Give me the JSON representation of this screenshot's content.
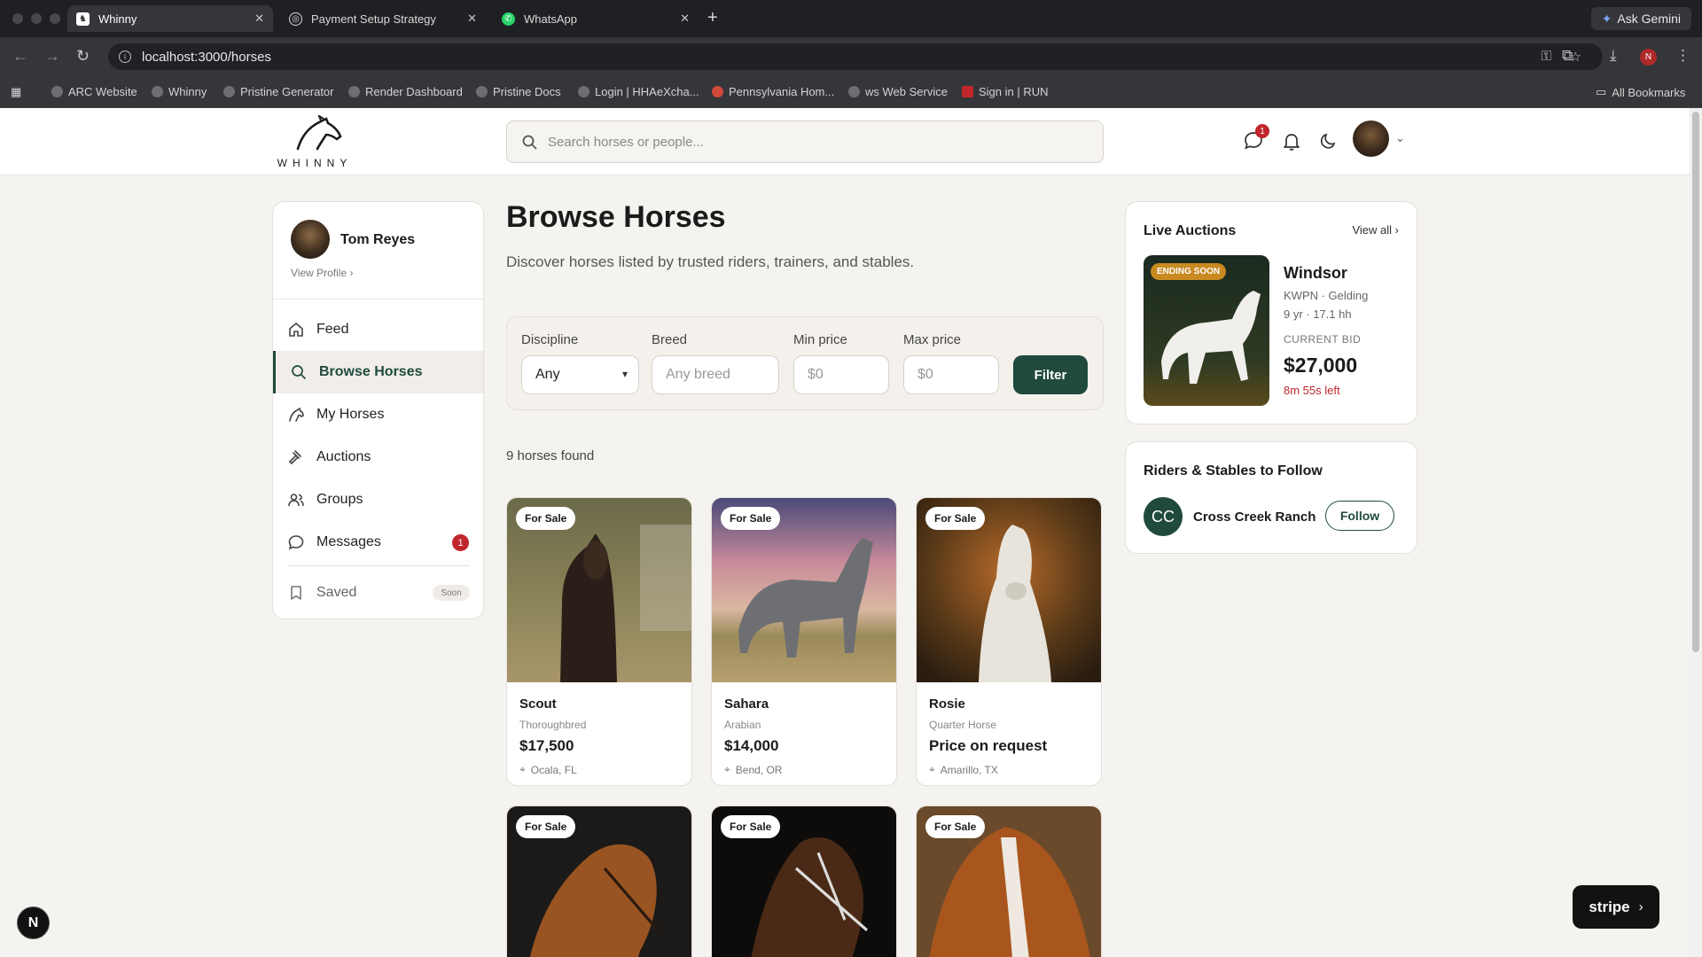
{
  "browser": {
    "tabs": [
      {
        "title": "Whinny"
      },
      {
        "title": "Payment Setup Strategy"
      },
      {
        "title": "WhatsApp"
      }
    ],
    "gemini_label": "Ask Gemini",
    "url": "localhost:3000/horses",
    "profile_initial": "N",
    "bookmarks": [
      {
        "label": "ARC Website"
      },
      {
        "label": "Whinny"
      },
      {
        "label": "Pristine Generator"
      },
      {
        "label": "Render Dashboard"
      },
      {
        "label": "Pristine Docs"
      },
      {
        "label": "Login | HHAeXcha..."
      },
      {
        "label": "Pennsylvania Hom..."
      },
      {
        "label": "ws Web Service"
      },
      {
        "label": "Sign in | RUN"
      }
    ],
    "all_bookmarks": "All Bookmarks"
  },
  "header": {
    "logo_text": "WHINNY",
    "search_placeholder": "Search horses or people...",
    "message_badge": "1"
  },
  "sidebar": {
    "user_name": "Tom Reyes",
    "view_profile": "View Profile ›",
    "items": [
      {
        "label": "Feed",
        "icon": "home-icon"
      },
      {
        "label": "Browse Horses",
        "icon": "search-icon"
      },
      {
        "label": "My Horses",
        "icon": "horse-icon"
      },
      {
        "label": "Auctions",
        "icon": "gavel-icon"
      },
      {
        "label": "Groups",
        "icon": "users-icon"
      },
      {
        "label": "Messages",
        "icon": "message-icon",
        "count": "1"
      },
      {
        "label": "Saved",
        "icon": "bookmark-icon",
        "tag": "Soon"
      }
    ]
  },
  "main": {
    "title": "Browse Horses",
    "subtitle": "Discover horses listed by trusted riders, trainers, and stables.",
    "filters": {
      "discipline_label": "Discipline",
      "discipline_value": "Any",
      "breed_label": "Breed",
      "breed_placeholder": "Any breed",
      "min_label": "Min price",
      "min_placeholder": "$0",
      "max_label": "Max price",
      "max_placeholder": "$0",
      "button": "Filter"
    },
    "found": "9 horses found",
    "badge": "For Sale",
    "horses": [
      {
        "name": "Scout",
        "breed": "Thoroughbred",
        "price": "$17,500",
        "location": "Ocala, FL"
      },
      {
        "name": "Sahara",
        "breed": "Arabian",
        "price": "$14,000",
        "location": "Bend, OR"
      },
      {
        "name": "Rosie",
        "breed": "Quarter Horse",
        "price": "Price on request",
        "location": "Amarillo, TX"
      }
    ]
  },
  "auctions": {
    "title": "Live Auctions",
    "view_all": "View all ›",
    "tag": "ENDING SOON",
    "name": "Windsor",
    "meta1": "KWPN · Gelding",
    "meta2": "9 yr · 17.1 hh",
    "bid_label": "CURRENT BID",
    "bid": "$27,000",
    "time_left": "8m 55s left"
  },
  "riders": {
    "title": "Riders & Stables to Follow",
    "initials": "CC",
    "name": "Cross Creek Ranch",
    "follow": "Follow"
  },
  "stripe_label": "stripe",
  "dev_badge": "N"
}
